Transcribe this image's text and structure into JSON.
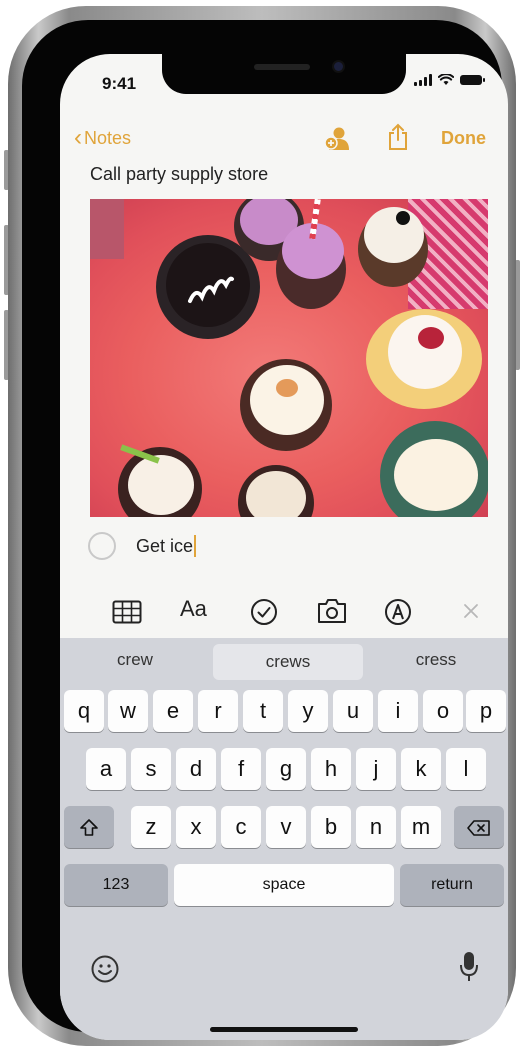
{
  "status": {
    "time": "9:41"
  },
  "nav": {
    "back_label": "Notes",
    "done_label": "Done"
  },
  "note": {
    "line1": "Call party supply store",
    "checklist_item": "Get ice"
  },
  "toolbar": {
    "icons": [
      "table-icon",
      "text-format-icon",
      "checklist-icon",
      "camera-icon",
      "markup-icon",
      "close-icon"
    ],
    "format_label": "Aa"
  },
  "keyboard": {
    "suggestions": [
      "crew",
      "crews",
      "cress"
    ],
    "row1": [
      "q",
      "w",
      "e",
      "r",
      "t",
      "y",
      "u",
      "i",
      "o",
      "p"
    ],
    "row2": [
      "a",
      "s",
      "d",
      "f",
      "g",
      "h",
      "j",
      "k",
      "l"
    ],
    "row3": [
      "z",
      "x",
      "c",
      "v",
      "b",
      "n",
      "m"
    ],
    "numbers_label": "123",
    "space_label": "space",
    "return_label": "return"
  },
  "colors": {
    "accent": "#e0a43a",
    "keyboard_bg": "#d2d4da",
    "note_bg": "#f6f6f4"
  }
}
